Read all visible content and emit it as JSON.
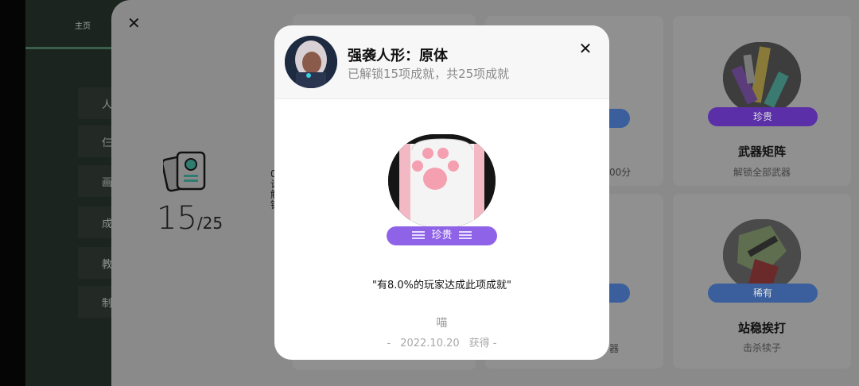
{
  "nav": {
    "home_label": "主页",
    "items": [
      "人",
      "仨",
      "画",
      "成",
      "教",
      "制"
    ]
  },
  "summary": {
    "unlocked": "15",
    "total": "/25",
    "cut_text": "0计解锁"
  },
  "cards": [
    {
      "title": "武器矩阵",
      "subtitle": "解锁全部武器",
      "badge": "珍贵",
      "badge_color": "#5a2fa8"
    },
    {
      "title": "站稳挨打",
      "subtitle": "击杀犊子",
      "badge": "稀有",
      "badge_color": "#3a5f9c"
    }
  ],
  "partial_texts": {
    "points": "00分",
    "weapon": "器"
  },
  "modal": {
    "title": "强袭人形：原体",
    "subtitle": "已解锁15项成就，共25项成就",
    "rarity": "珍贵",
    "rarity_color": "#8f63e8",
    "quote": "\"有8.0%的玩家达成此项成就\"",
    "achievement_name": "喵",
    "date_prefix": "-",
    "date": "2022.10.20",
    "date_suffix": "获得 -",
    "badge_icon": "cat-paw-icon",
    "close_icon": "close-icon"
  }
}
